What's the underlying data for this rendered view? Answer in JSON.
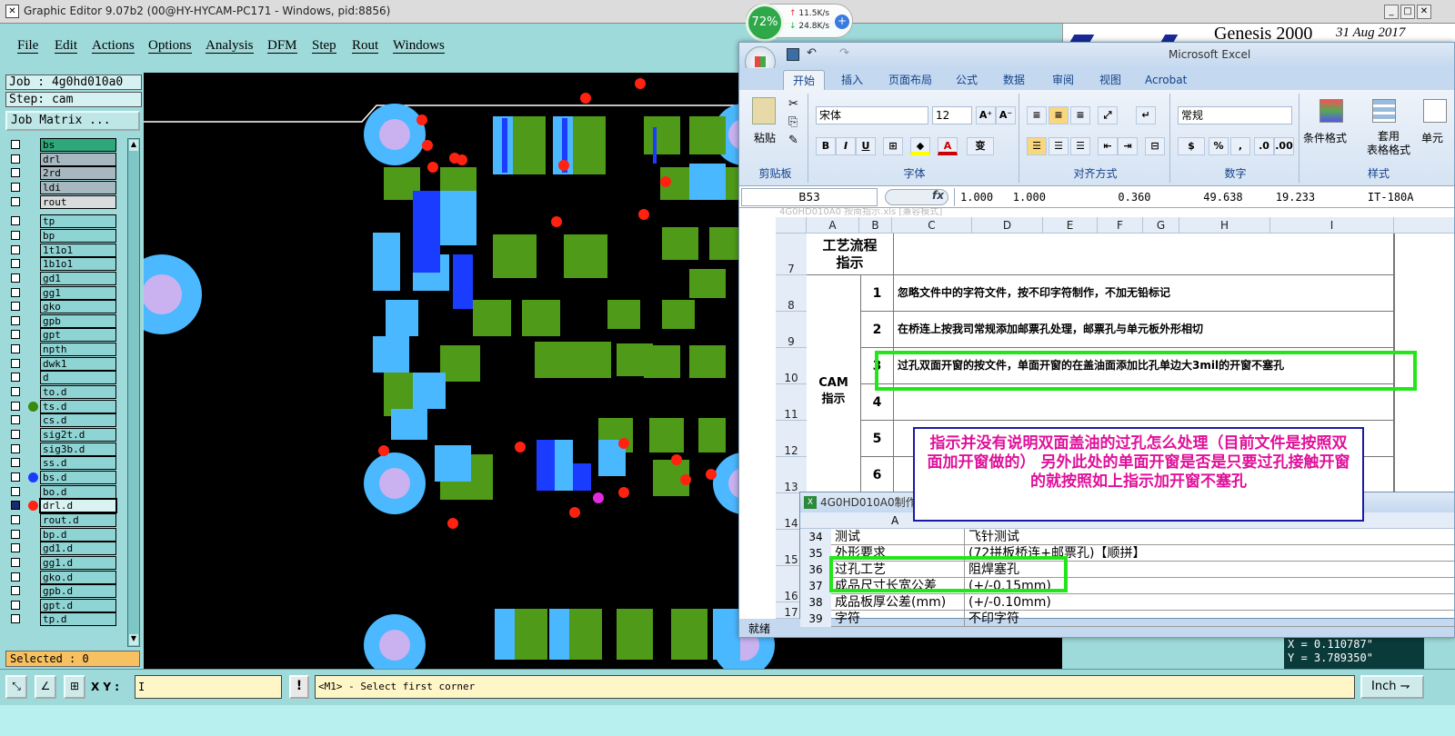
{
  "title_bar": {
    "icon_glyph": "✕",
    "title": "Graphic Editor 9.07b2 (00@HY-HYCAM-PC171 - Windows, pid:8856)",
    "minimize": "_",
    "maximize": "□",
    "close": "✕"
  },
  "menu": [
    "File",
    "Edit",
    "Actions",
    "Options",
    "Analysis",
    "DFM",
    "Step",
    "Rout",
    "Windows"
  ],
  "job_info": {
    "job": "Job : 4g0hd010a0",
    "step": "Step: cam",
    "job_matrix_button": "Job Matrix ..."
  },
  "layers": [
    {
      "name": "bs",
      "color": "#2ea87a"
    },
    {
      "name": "drl",
      "color": "#a8b8c0"
    },
    {
      "name": "2rd",
      "color": "#a8b8c0"
    },
    {
      "name": "ldi",
      "color": "#a8b8c0"
    },
    {
      "name": "rout",
      "color": "#d8dcdc"
    },
    {
      "name": "tp",
      "color": "#8ed4d4"
    },
    {
      "name": "bp",
      "color": "#8ed4d4"
    },
    {
      "name": "1t1o1",
      "color": "#8ed4d4"
    },
    {
      "name": "1b1o1",
      "color": "#8ed4d4"
    },
    {
      "name": "gd1",
      "color": "#8ed4d4"
    },
    {
      "name": "gg1",
      "color": "#8ed4d4"
    },
    {
      "name": "gko",
      "color": "#8ed4d4"
    },
    {
      "name": "gpb",
      "color": "#8ed4d4"
    },
    {
      "name": "gpt",
      "color": "#8ed4d4"
    },
    {
      "name": "npth",
      "color": "#8ed4d4"
    },
    {
      "name": "dwk1",
      "color": "#8ed4d4"
    },
    {
      "name": "d",
      "color": "#8ed4d4"
    },
    {
      "name": "to.d",
      "color": "#8ed4d4"
    },
    {
      "name": "ts.d",
      "color": "#8ed4d4"
    },
    {
      "name": "cs.d",
      "color": "#8ed4d4"
    },
    {
      "name": "sig2t.d",
      "color": "#8ed4d4"
    },
    {
      "name": "sig3b.d",
      "color": "#8ed4d4"
    },
    {
      "name": "ss.d",
      "color": "#8ed4d4"
    },
    {
      "name": "bs.d",
      "color": "#8ed4d4"
    },
    {
      "name": "bo.d",
      "color": "#8ed4d4"
    },
    {
      "name": "drl.d",
      "color": "#8ed4d4"
    },
    {
      "name": "rout.d",
      "color": "#8ed4d4"
    },
    {
      "name": "bp.d",
      "color": "#8ed4d4"
    },
    {
      "name": "gd1.d",
      "color": "#8ed4d4"
    },
    {
      "name": "gg1.d",
      "color": "#8ed4d4"
    },
    {
      "name": "gko.d",
      "color": "#8ed4d4"
    },
    {
      "name": "gpb.d",
      "color": "#8ed4d4"
    },
    {
      "name": "gpt.d",
      "color": "#8ed4d4"
    },
    {
      "name": "tp.d",
      "color": "#8ed4d4"
    }
  ],
  "layer_markers": {
    "ts_d": "#3a8a10",
    "bs_d": "#1a3cff",
    "drl_d": "#f21"
  },
  "selected_label": "Selected : 0",
  "genesis": {
    "product": "Genesis 2000",
    "date": "31 Aug 2017"
  },
  "network": {
    "cpu_percent": "72%",
    "upload": "11.5K/s",
    "download": "24.8K/s"
  },
  "bottom": {
    "xy_label": "X Y :",
    "xy_value": "I",
    "warn_glyph": "!",
    "status": "<M1> - Select first corner",
    "unit": "Inch",
    "unit_arrow": "⇁",
    "coord_x": "X = 0.110787\"",
    "coord_y": "Y = 3.789350\""
  },
  "excel": {
    "app_title": "Microsoft Excel",
    "tabs": [
      "开始",
      "插入",
      "页面布局",
      "公式",
      "数据",
      "审阅",
      "视图",
      "Acrobat"
    ],
    "ribbon": {
      "paste": "粘贴",
      "clipboard": "剪贴板",
      "font_name": "宋体",
      "font_size": "12",
      "font_group": "字体",
      "align_group": "对齐方式",
      "number_format": "常规",
      "number_group": "数字",
      "cond_format": "条件格式",
      "table_format": "套用\n表格格式",
      "cell_style": "单元",
      "style_group": "样式",
      "font_grow": "A⁺",
      "font_shrink": "A⁻",
      "bold": "B",
      "italic": "I",
      "underline": "U",
      "phonetic": "变"
    },
    "name_box": "B53",
    "fx": "fx",
    "formula": "1.000   1.000           0.360        49.638     19.233        IT-180A",
    "ghost_title": "4G0HD010A0 按南指示.xls  [兼容模式]",
    "columns": [
      "A",
      "B",
      "C",
      "D",
      "E",
      "F",
      "G",
      "H",
      "I"
    ],
    "row_numbers": [
      "7",
      "8",
      "9",
      "10",
      "11",
      "12",
      "13",
      "14",
      "15",
      "16",
      "17"
    ],
    "section1": "工艺流程\n指示",
    "section2": "CAM\n指示",
    "items": [
      {
        "no": "1",
        "text": "忽略文件中的字符文件，按不印字符制作，不加无铅标记"
      },
      {
        "no": "2",
        "text": "在桥连上按我司常规添加邮票孔处理，邮票孔与单元板外形相切"
      },
      {
        "no": "3",
        "text": "过孔双面开窗的按文件，单面开窗的在盖油面添加比孔单边大3mil的开窗不塞孔"
      },
      {
        "no": "4",
        "text": ""
      },
      {
        "no": "5",
        "text": ""
      },
      {
        "no": "6",
        "text": ""
      }
    ],
    "status_text": "就绪"
  },
  "inner_window": {
    "title": "4G0HD010A0制作",
    "col_a": "A",
    "rows": [
      {
        "no": "34",
        "a": "测试",
        "b": "飞针测试"
      },
      {
        "no": "35",
        "a": "外形要求",
        "b": "(72拼板桥连+邮票孔)【顺拼】"
      },
      {
        "no": "36",
        "a": "过孔工艺",
        "b": "阻焊塞孔"
      },
      {
        "no": "37",
        "a": "成品尺寸长宽公差",
        "b": "(+/-0.15mm)"
      },
      {
        "no": "38",
        "a": "成品板厚公差(mm)",
        "b": "(+/-0.10mm)"
      },
      {
        "no": "39",
        "a": "字符",
        "b": "不印字符"
      }
    ]
  },
  "annotation": "指示并没有说明双面盖油的过孔怎么处理（目前文件是按照双面加开窗做的）  另外此处的单面开窗是否是只要过孔接触开窗的就按照如上指示加开窗不塞孔"
}
